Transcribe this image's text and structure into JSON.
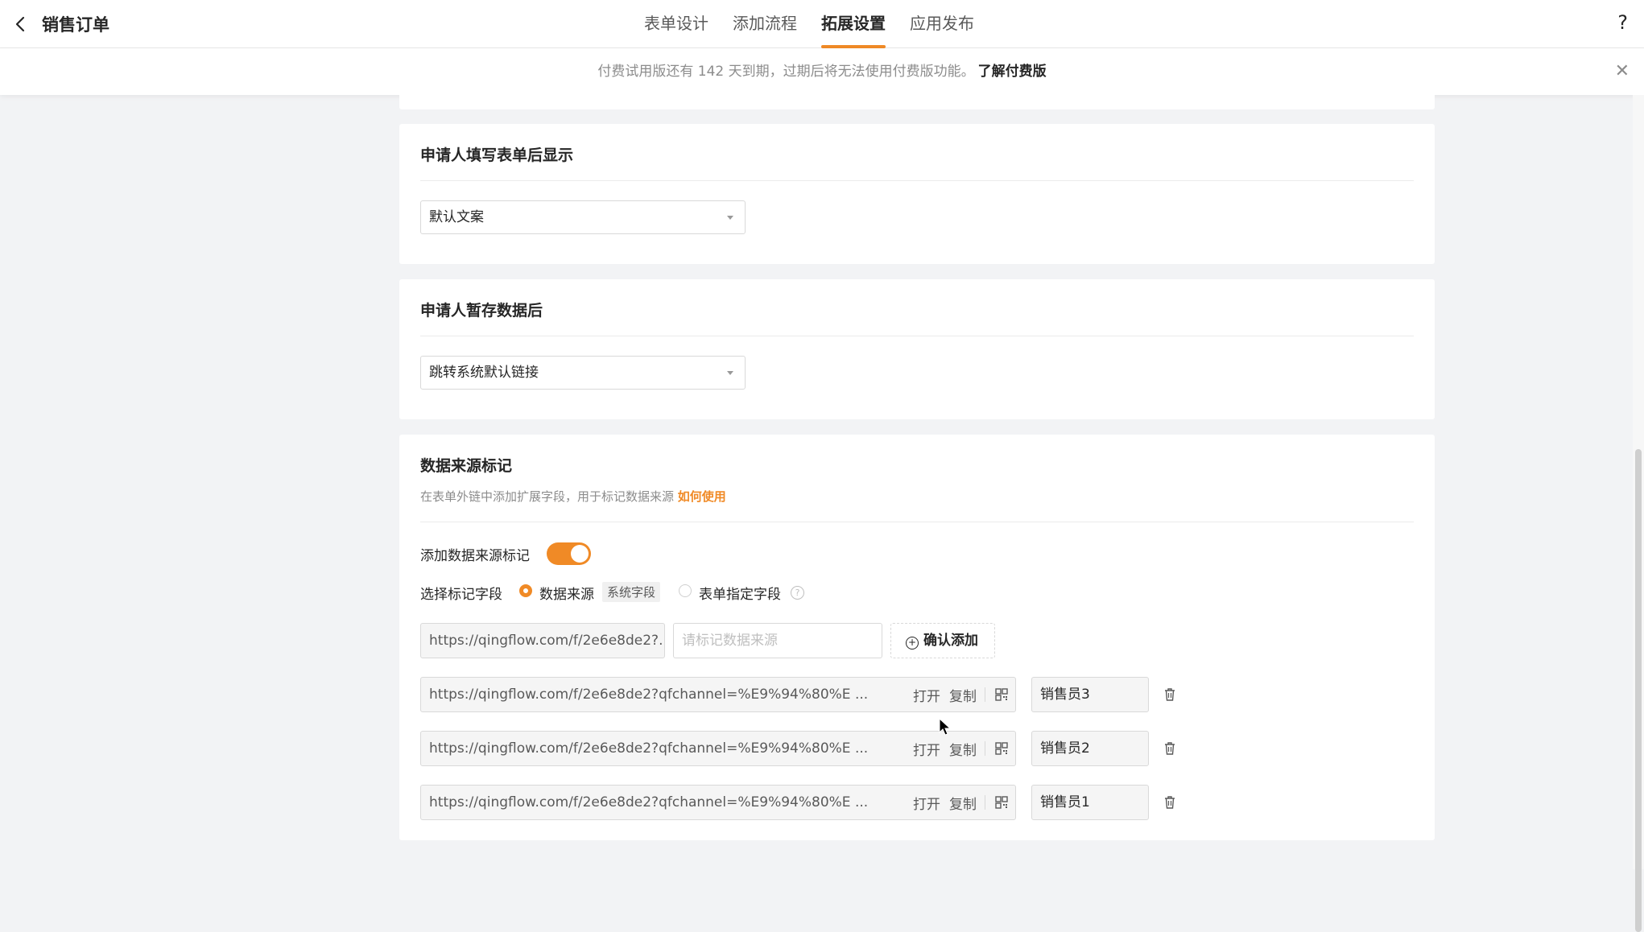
{
  "header": {
    "title": "销售订单",
    "tabs": [
      {
        "label": "表单设计",
        "active": false
      },
      {
        "label": "添加流程",
        "active": false
      },
      {
        "label": "拓展设置",
        "active": true
      },
      {
        "label": "应用发布",
        "active": false
      }
    ],
    "help_label": "?"
  },
  "notice": {
    "text": "付费试用版还有 142 天到期，过期后将无法使用付费版功能。",
    "link": "了解付费版"
  },
  "after_fill": {
    "title": "申请人填写表单后显示",
    "selected": "默认文案"
  },
  "after_save": {
    "title": "申请人暂存数据后",
    "selected": "跳转系统默认链接"
  },
  "source_mark": {
    "title": "数据来源标记",
    "desc": "在表单外链中添加扩展字段，用于标记数据来源",
    "how_to": "如何使用",
    "toggle_label": "添加数据来源标记",
    "toggle_on": true,
    "field_label": "选择标记字段",
    "option_data_source": "数据来源",
    "option_tag": "系统字段",
    "option_form_field": "表单指定字段",
    "new_link": "https://qingflow.com/f/2e6e8de2?...",
    "input_placeholder": "请标记数据来源",
    "confirm_label": "确认添加",
    "open_label": "打开",
    "copy_label": "复制",
    "links": [
      {
        "url": "https://qingflow.com/f/2e6e8de2?qfchannel=%E9%94%80%E  ...",
        "name": "销售员3"
      },
      {
        "url": "https://qingflow.com/f/2e6e8de2?qfchannel=%E9%94%80%E  ...",
        "name": "销售员2"
      },
      {
        "url": "https://qingflow.com/f/2e6e8de2?qfchannel=%E9%94%80%E  ...",
        "name": "销售员1"
      }
    ]
  },
  "colors": {
    "accent": "#f08a26",
    "background": "#f2f3f5"
  }
}
